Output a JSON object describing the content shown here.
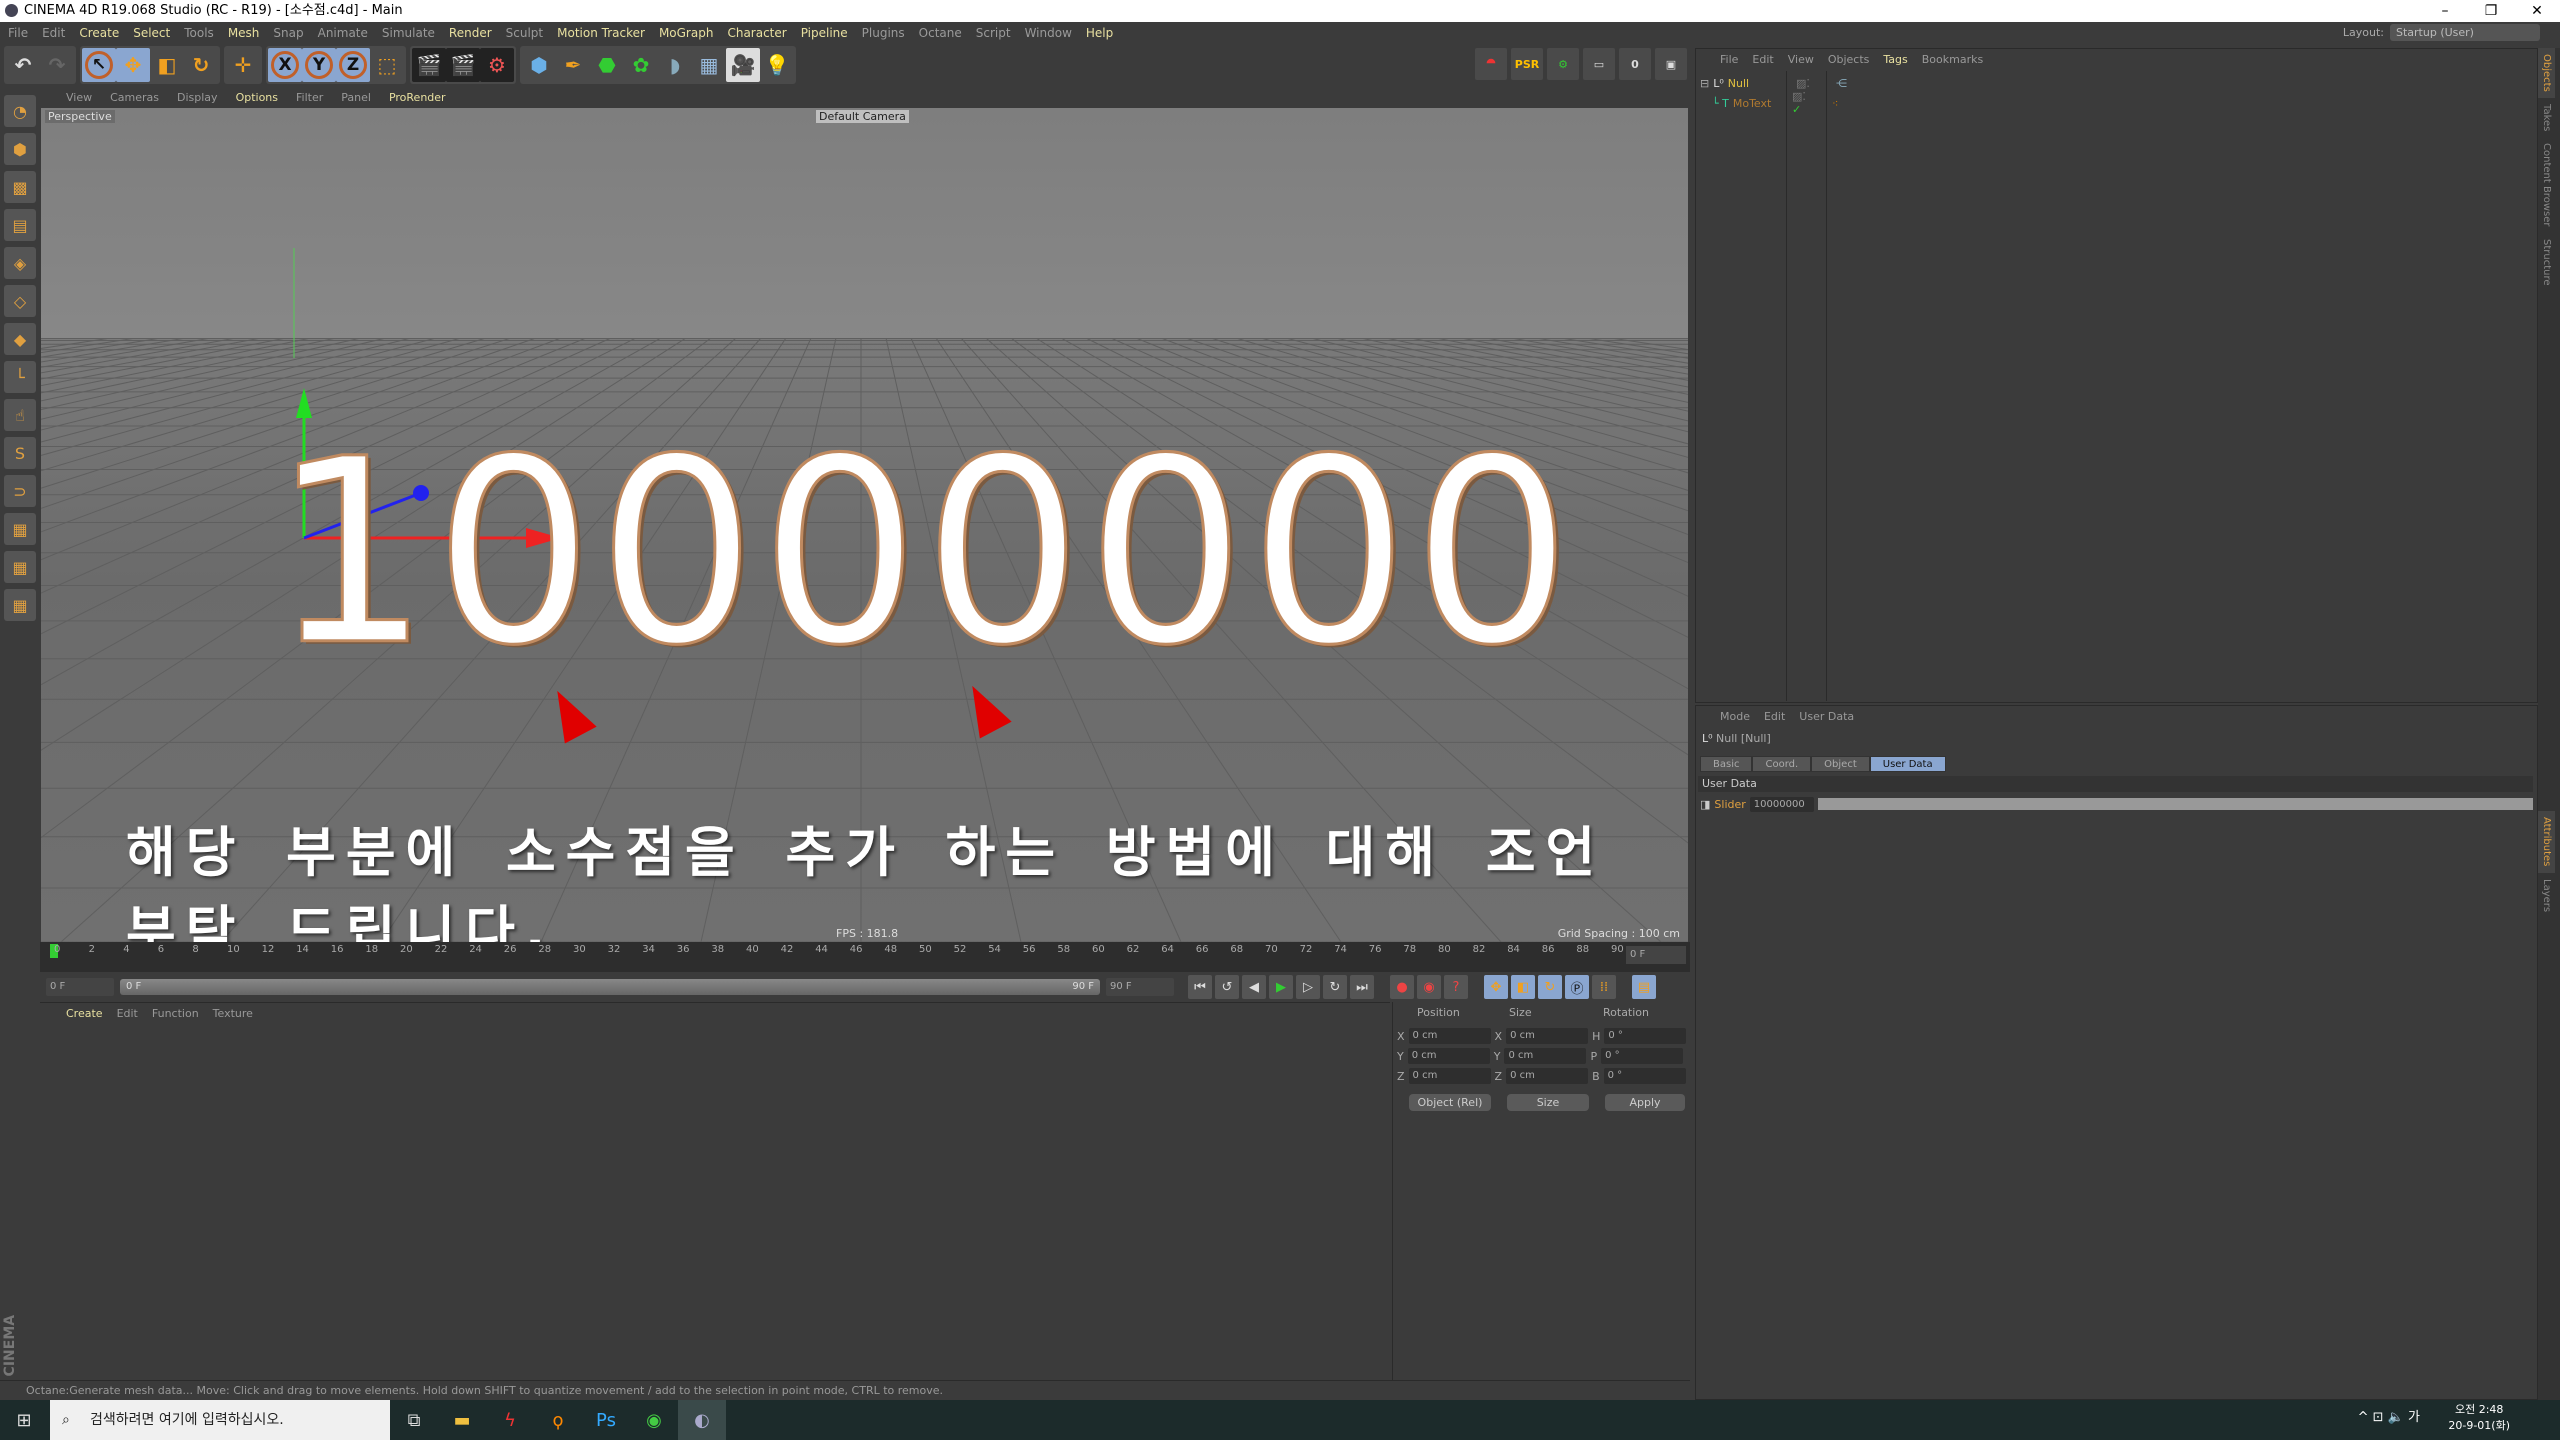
{
  "window": {
    "title": "CINEMA 4D R19.068 Studio (RC - R19) - [소수점.c4d] - Main",
    "controls": [
      "–",
      "❐",
      "✕"
    ]
  },
  "menu": [
    {
      "label": "File"
    },
    {
      "label": "Edit"
    },
    {
      "label": "Create",
      "hl": true
    },
    {
      "label": "Select",
      "hl": true
    },
    {
      "label": "Tools"
    },
    {
      "label": "Mesh",
      "hl": true
    },
    {
      "label": "Snap"
    },
    {
      "label": "Animate"
    },
    {
      "label": "Simulate"
    },
    {
      "label": "Render",
      "hl": true
    },
    {
      "label": "Sculpt"
    },
    {
      "label": "Motion Tracker",
      "hl": true
    },
    {
      "label": "MoGraph",
      "hl": true
    },
    {
      "label": "Character",
      "hl": true
    },
    {
      "label": "Pipeline",
      "hl": true
    },
    {
      "label": "Plugins"
    },
    {
      "label": "Octane"
    },
    {
      "label": "Script"
    },
    {
      "label": "Window"
    },
    {
      "label": "Help",
      "hl": true
    }
  ],
  "layout": {
    "label": "Layout:",
    "value": "Startup (User)"
  },
  "toolbar": {
    "axis": [
      "X",
      "Y",
      "Z"
    ],
    "psr": "PSR",
    "psr_value": "0"
  },
  "viewport": {
    "menu": [
      {
        "label": "View"
      },
      {
        "label": "Cameras"
      },
      {
        "label": "Display"
      },
      {
        "label": "Options",
        "hl": true
      },
      {
        "label": "Filter"
      },
      {
        "label": "Panel"
      },
      {
        "label": "ProRender",
        "hl": true
      }
    ],
    "projection": "Perspective",
    "camera": "Default Camera",
    "text_object": "10000000",
    "annotation": "해당 부분에 소수점을 추가 하는 방법에 대해 조언 부탁 드립니다.",
    "fps": "FPS : 181.8",
    "grid_spacing": "Grid Spacing : 100 cm"
  },
  "timeline": {
    "ticks": [
      "0",
      "2",
      "4",
      "6",
      "8",
      "10",
      "12",
      "14",
      "16",
      "18",
      "20",
      "22",
      "24",
      "26",
      "28",
      "30",
      "32",
      "34",
      "36",
      "38",
      "40",
      "42",
      "44",
      "46",
      "48",
      "50",
      "52",
      "54",
      "56",
      "58",
      "60",
      "62",
      "64",
      "66",
      "68",
      "70",
      "72",
      "74",
      "76",
      "78",
      "80",
      "82",
      "84",
      "86",
      "88",
      "90"
    ],
    "current": "0 F",
    "start": "0 F",
    "range_start": "0 F",
    "range_end": "90 F",
    "end": "90 F"
  },
  "transport": [
    "⏮",
    "↺",
    "◀",
    "▶",
    "▷",
    "↻",
    "⏭"
  ],
  "materials": {
    "menu": [
      {
        "label": "Create",
        "hl": true
      },
      {
        "label": "Edit"
      },
      {
        "label": "Function"
      },
      {
        "label": "Texture"
      }
    ]
  },
  "coordinates": {
    "headers": [
      "Position",
      "Size",
      "Rotation"
    ],
    "rows": [
      {
        "a": "X",
        "p": "0 cm",
        "b": "X",
        "s": "0 cm",
        "c": "H",
        "r": "0 °"
      },
      {
        "a": "Y",
        "p": "0 cm",
        "b": "Y",
        "s": "0 cm",
        "c": "P",
        "r": "0 °"
      },
      {
        "a": "Z",
        "p": "0 cm",
        "b": "Z",
        "s": "0 cm",
        "c": "B",
        "r": "0 °"
      }
    ],
    "mode": "Object (Rel)",
    "size_mode": "Size",
    "apply": "Apply"
  },
  "status": "Octane:Generate mesh data...   Move: Click and drag to move elements. Hold down SHIFT to quantize movement / add to the selection in point mode, CTRL to remove.",
  "objects": {
    "menu": [
      {
        "label": "File"
      },
      {
        "label": "Edit"
      },
      {
        "label": "View"
      },
      {
        "label": "Objects"
      },
      {
        "label": "Tags",
        "hl": true
      },
      {
        "label": "Bookmarks"
      }
    ],
    "items": [
      {
        "name": "Null",
        "color": "#e0c040"
      },
      {
        "name": "MoText",
        "color": "#b07a30"
      }
    ]
  },
  "attributes": {
    "menu": [
      "Mode",
      "Edit",
      "User Data"
    ],
    "object": "Null [Null]",
    "tabs": [
      "Basic",
      "Coord.",
      "Object",
      "User Data"
    ],
    "active_tab": "User Data",
    "section": "User Data",
    "slider_label": "Slider",
    "slider_value": "10000000",
    "slider_fill_percent": 100
  },
  "side_tabs": [
    "Objects",
    "Takes",
    "Content Browser",
    "Structure",
    "Attributes",
    "Layers"
  ],
  "taskbar": {
    "search_placeholder": "검색하려면 여기에 입력하십시오.",
    "time": "오전 2:48",
    "date": "20-9-01(화)",
    "ime": "가"
  },
  "colors": {
    "accent": "#8aa6d0",
    "highlight_text": "#e8e0a0",
    "taskbar": "#1c2b2b"
  }
}
